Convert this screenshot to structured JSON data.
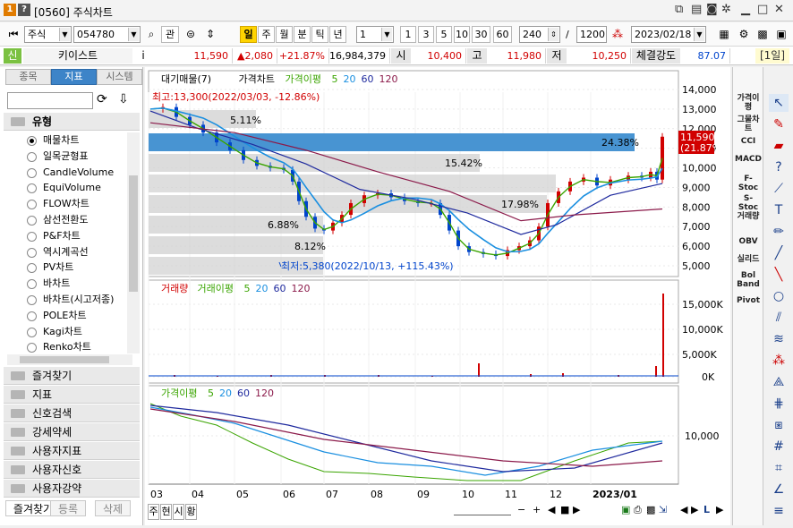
{
  "window": {
    "badge1": "1",
    "badge2": "?",
    "title": "[0560] 주식차트"
  },
  "toolbar": {
    "market": "주식",
    "code": "054780",
    "btn_manage": "관",
    "period_btns": [
      "일",
      "주",
      "월",
      "분",
      "틱",
      "년"
    ],
    "multiplier": "1",
    "nums": [
      "1",
      "3",
      "5",
      "10",
      "30",
      "60"
    ],
    "count": "240",
    "slash": "/",
    "total": "1200",
    "date": "2023/02/18"
  },
  "quote": {
    "market_tag": "신",
    "name": "키이스트",
    "info": "i",
    "price": "11,590",
    "change": "▲2,080",
    "rate": "+21.87%",
    "volume": "16,984,379",
    "open_lbl": "시",
    "open": "10,400",
    "high_lbl": "고",
    "high": "11,980",
    "low_lbl": "저",
    "low": "10,250",
    "strength_lbl": "체결강도",
    "strength": "87.07",
    "period": "[1일]"
  },
  "left": {
    "tabs": [
      "종목",
      "지표",
      "시스템"
    ],
    "group_title": "유형",
    "items": [
      "매물차트",
      "일목균형표",
      "CandleVolume",
      "EquiVolume",
      "FLOW차트",
      "삼선전환도",
      "P&F차트",
      "역시계곡선",
      "PV차트",
      "바차트",
      "바차트(시고저종)",
      "POLE차트",
      "Kagi차트",
      "Renko차트"
    ],
    "folders": [
      "즐겨찾기",
      "지표",
      "신호검색",
      "강세약세",
      "사용자지표",
      "사용자신호",
      "사용자강약"
    ],
    "bottom_tabs": [
      "즐겨찾기",
      "등록",
      "삭제"
    ]
  },
  "legends": {
    "main": [
      "대기매물(7)",
      "가격차트",
      "가격이평",
      "5",
      "20",
      "60",
      "120"
    ],
    "volume": [
      "거래량",
      "거래이평",
      "5",
      "20",
      "60",
      "120"
    ],
    "osc": [
      "가격이평",
      "5",
      "20",
      "60",
      "120"
    ]
  },
  "annotations": {
    "high": "최고:13,300(2022/03/03, -12.86%)",
    "low": "최저:5,380(2022/10/13, +115.43%)",
    "current_price": "11,590",
    "current_rate": "(21.87%)"
  },
  "vp_bars": [
    {
      "pct": "5.11%"
    },
    {
      "pct": "24.38%"
    },
    {
      "pct": "15.42%"
    },
    {
      "pct": "17.98%"
    },
    {
      "pct": "6.88%"
    },
    {
      "pct": "8.12%"
    }
  ],
  "axes": {
    "price_ticks": [
      "14,000",
      "13,000",
      "12,000",
      "11,000",
      "10,000",
      "9,000",
      "8,000",
      "7,000",
      "6,000",
      "5,000"
    ],
    "volume_ticks": [
      "15,000K",
      "10,000K",
      "5,000K",
      "0K"
    ],
    "osc_ticks": [
      "10,000"
    ],
    "x_ticks": [
      "03",
      "04",
      "05",
      "06",
      "07",
      "08",
      "09",
      "10",
      "11",
      "12",
      "2023/01"
    ]
  },
  "right_indicators": [
    "가격이평",
    "그물차트",
    "CCI",
    "MACD",
    "F-Stoc",
    "S-Stoc",
    "거래량",
    "OBV",
    "실리드",
    "Bol Band",
    "Pivot"
  ],
  "bottom": {
    "btns": [
      "주",
      "현",
      "시",
      "황"
    ]
  },
  "colors": {
    "up": "#d10000",
    "down": "#0044cc",
    "ma5": "#3aa400",
    "ma20": "#1a8fe0",
    "ma60": "#1f2a9e",
    "ma120": "#8b1a4a",
    "vp_bar": "#d0d0d0",
    "vp_max": "#3e8ed0"
  }
}
